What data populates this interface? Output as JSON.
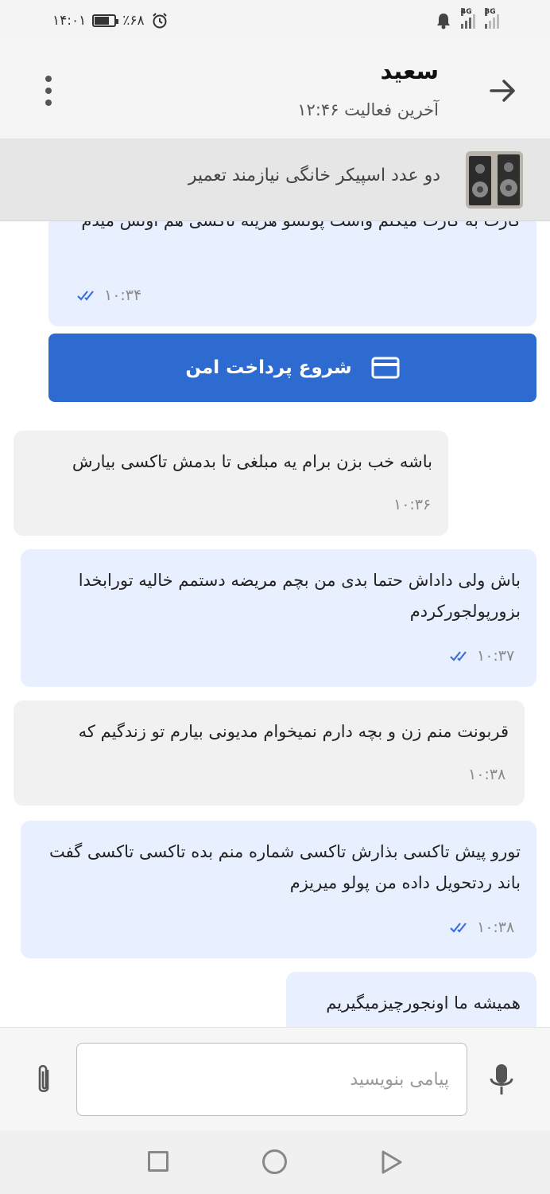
{
  "status_bar": {
    "time": "۱۴:۰۱",
    "battery": "٪۶۸",
    "network_labels": [
      "4G",
      "3G"
    ]
  },
  "header": {
    "contact_name": "سعید",
    "last_seen": "آخرین فعالیت ۱۲:۴۶"
  },
  "listing": {
    "title": "دو عدد اسپیکر خانگی نیازمند تعمیر"
  },
  "pay_button": {
    "label": "شروع پرداخت امن"
  },
  "messages": [
    {
      "direction": "out",
      "text": "کارت به کارت میکنم واست پولشو هزینه تاکسی هم اونش میدم",
      "time": "۱۰:۳۴",
      "read": true
    },
    {
      "direction": "in",
      "text": "باشه خب بزن برام یه مبلغی تا بدمش تاکسی بیارش",
      "time": "۱۰:۳۶"
    },
    {
      "direction": "out",
      "text": "باش ولی داداش حتما بدی من بچم مریضه دستمم خالیه تورابخدا بزورپولجورکردم",
      "time": "۱۰:۳۷",
      "read": true
    },
    {
      "direction": "in",
      "text": "قربونت منم زن و بچه دارم نمیخوام مدیونی بیارم تو زندگیم که",
      "time": "۱۰:۳۸"
    },
    {
      "direction": "out",
      "text": "تورو پیش تاکسی بذارش تاکسی شماره منم بده تاکسی تاکسی گفت باند ردتحویل داده من پولو میریزم",
      "time": "۱۰:۳۸",
      "read": true
    },
    {
      "direction": "in",
      "text": "همیشه ما اونجورچیزمیگیریم",
      "time": ""
    }
  ],
  "composer": {
    "placeholder": "پیامی بنویسید"
  },
  "colors": {
    "accent": "#2d6bd1",
    "outgoing_bubble": "#e8efff",
    "incoming_bubble": "#f1f1f1",
    "read_ticks": "#3b6fd6"
  }
}
